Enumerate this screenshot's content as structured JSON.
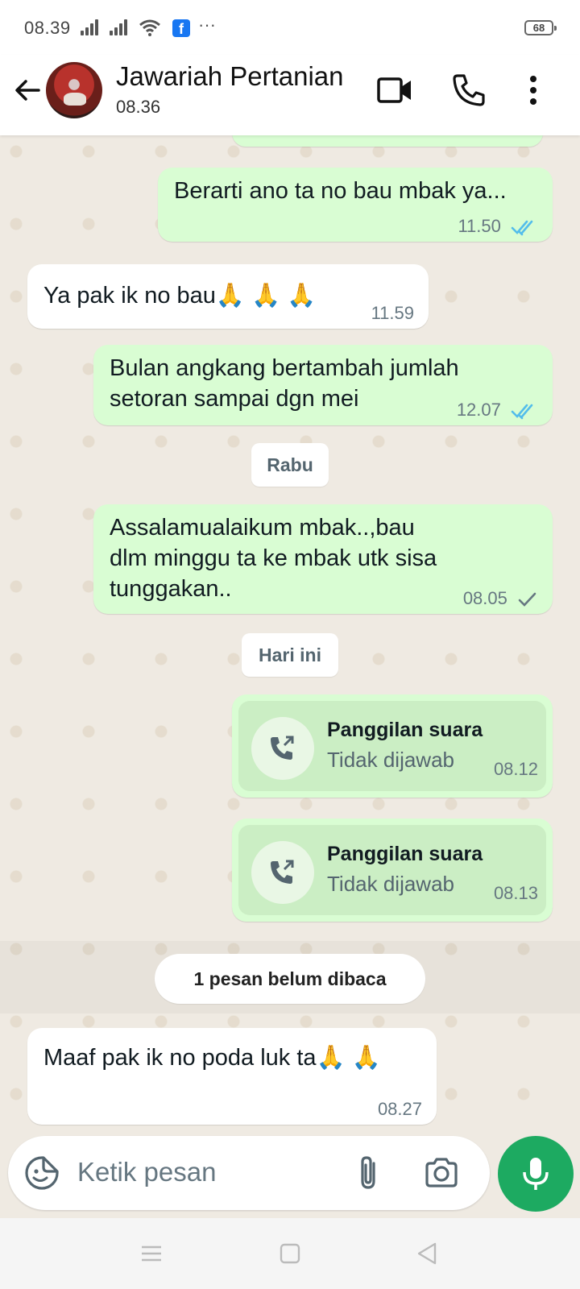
{
  "status_bar": {
    "time": "08.39",
    "battery": "68"
  },
  "header": {
    "contact_name": "Jawariah Pertanian",
    "last_seen": "08.36"
  },
  "messages": [
    {
      "text": "Berarti ano ta no bau mbak ya...",
      "time": "11.50",
      "status": "read"
    },
    {
      "text": "Ya pak ik no bau🙏 🙏 🙏",
      "time": "11.59"
    },
    {
      "line1": "Bulan angkang bertambah jumlah",
      "line2": "setoran sampai dgn mei",
      "time": "12.07",
      "status": "read"
    },
    {
      "line1": "Assalamualaikum mbak..,bau",
      "line2": "dlm minggu ta ke mbak utk sisa",
      "line3": "tunggakan..",
      "time": "08.05",
      "status": "sent"
    },
    {
      "text": "Maaf pak ik no poda luk ta🙏 🙏",
      "time": "08.27"
    }
  ],
  "day_labels": {
    "wed": "Rabu",
    "today": "Hari ini"
  },
  "calls": [
    {
      "title": "Panggilan suara",
      "status": "Tidak dijawab",
      "time": "08.12"
    },
    {
      "title": "Panggilan suara",
      "status": "Tidak dijawab",
      "time": "08.13"
    }
  ],
  "unread_notice": "1 pesan belum dibaca",
  "composer": {
    "placeholder": "Ketik pesan"
  },
  "colors": {
    "outgoing": "#d9fdd3",
    "incoming": "#ffffff",
    "accent": "#1daa61",
    "read_tick": "#53bdeb"
  },
  "icons": [
    "back-arrow-icon",
    "video-call-icon",
    "phone-icon",
    "more-vert-icon",
    "call-missed-icon",
    "sticker-icon",
    "attach-icon",
    "camera-icon",
    "mic-icon"
  ]
}
